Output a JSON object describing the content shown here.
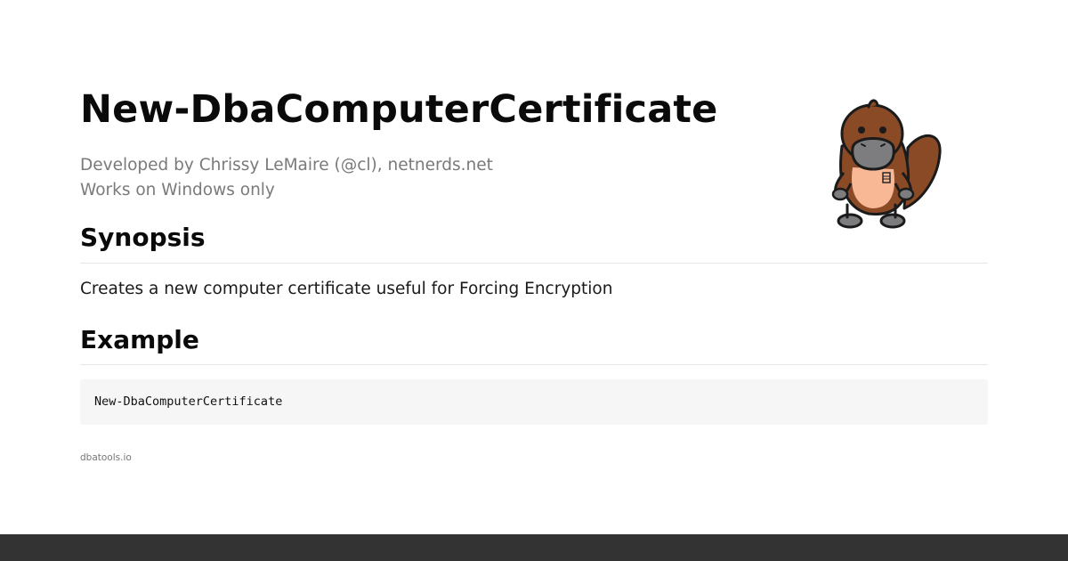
{
  "page": {
    "title": "New-DbaComputerCertificate",
    "author_line": "Developed by Chrissy LeMaire (@cl), netnerds.net",
    "platform_line": "Works on Windows only"
  },
  "mascot": {
    "icon": "platypus-mascot-icon",
    "badge_text": "",
    "colors": {
      "body": "#8a4a26",
      "belly": "#f8b896",
      "bill": "#7d7d80",
      "outline": "#1b1b1b"
    }
  },
  "synopsis": {
    "heading": "Synopsis",
    "text": "Creates a new computer certificate useful for Forcing Encryption"
  },
  "example": {
    "heading": "Example",
    "code": "New-DbaComputerCertificate"
  },
  "footer": {
    "site": "dbatools.io"
  },
  "colors": {
    "heading": "#0a0a0a",
    "meta_text": "#7a7a7a",
    "code_bg": "#f6f6f6",
    "bottom_bar": "#333333"
  }
}
